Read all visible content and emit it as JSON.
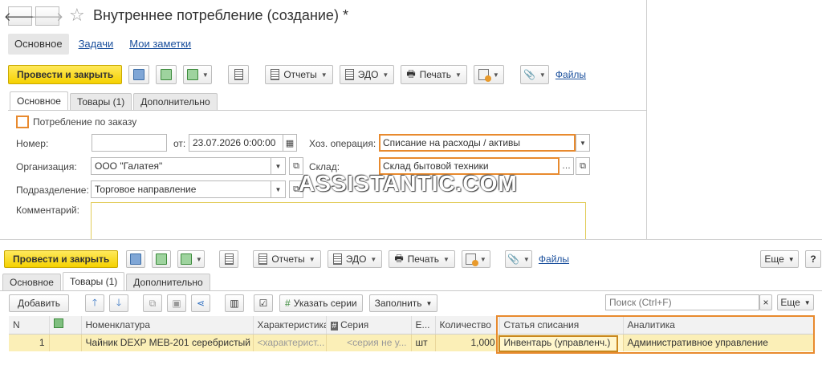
{
  "win1": {
    "title": "Внутреннее потребление (создание) *",
    "nav": {
      "back": "🡐",
      "forward": "🡒",
      "star": "☆"
    },
    "section_tabs": [
      "Основное",
      "Задачи",
      "Мои заметки"
    ],
    "toolbar": {
      "post_close": "Провести и закрыть",
      "reports": "Отчеты",
      "edo": "ЭДО",
      "print": "Печать",
      "files": "Файлы"
    },
    "form_tabs": [
      "Основное",
      "Товары (1)",
      "Дополнительно"
    ],
    "fields": {
      "by_order": "Потребление по заказу",
      "number_label": "Номер:",
      "number_value": "",
      "date_label": "от:",
      "date_value": "23.07.2026  0:00:00",
      "operation_label": "Хоз. операция:",
      "operation_value": "Списание на расходы / активы",
      "org_label": "Организация:",
      "org_value": "ООО \"Галатея\"",
      "warehouse_label": "Склад:",
      "warehouse_value": "Склад бытовой техники",
      "dept_label": "Подразделение:",
      "dept_value": "Торговое направление",
      "comment_label": "Комментарий:",
      "comment_value": ""
    }
  },
  "watermark": "ASSISTANTIC.COM",
  "win2": {
    "toolbar": {
      "post_close": "Провести и закрыть",
      "reports": "Отчеты",
      "edo": "ЭДО",
      "print": "Печать",
      "files": "Файлы",
      "more": "Еще",
      "help": "?"
    },
    "form_tabs": [
      "Основное",
      "Товары (1)",
      "Дополнительно"
    ],
    "table_toolbar": {
      "add": "Добавить",
      "series": "Указать серии",
      "fill": "Заполнить",
      "search_placeholder": "Поиск (Ctrl+F)",
      "clear": "×",
      "more": "Еще"
    },
    "columns": [
      "N",
      "",
      "Номенклатура",
      "Характеристика",
      "Серия",
      "Е...",
      "Количество",
      "Статья списания",
      "Аналитика"
    ],
    "rows": [
      {
        "n": "1",
        "flag": "",
        "item": "Чайник DEXP MEB-201 серебристый",
        "characteristic": "<характерист...",
        "series": "<серия не у...",
        "unit": "шт",
        "qty": "1,000",
        "expense_item": "Инвентарь (управленч.)",
        "analytics": "Административное управление"
      }
    ]
  }
}
